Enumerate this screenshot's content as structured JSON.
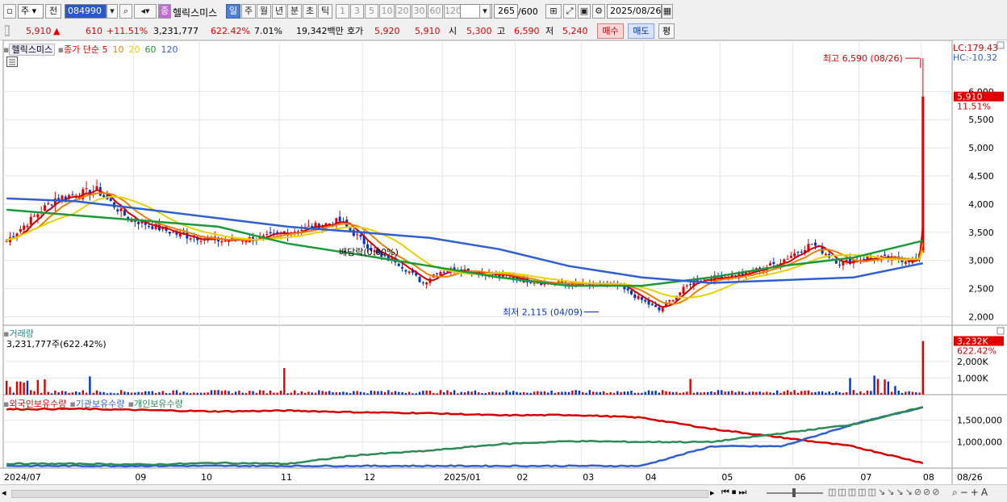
{
  "toolbar": {
    "period_select": "주",
    "prev_label": "전",
    "code": "084990",
    "stock_name": "헬릭스미스",
    "stock_badge": "종",
    "period_tabs": [
      "일",
      "주",
      "월",
      "년",
      "분",
      "초",
      "틱"
    ],
    "active_tab": "일",
    "minute_tabs": [
      "1",
      "3",
      "5",
      "10",
      "20",
      "30",
      "60",
      "120"
    ],
    "count_value": "265",
    "count_max": "/600",
    "date_value": "2025/08/26"
  },
  "quote": {
    "price": "5,910",
    "change": "610",
    "change_pct": "+11.51%",
    "volume": "3,231,777",
    "volume_ratio": "622.42%",
    "turnover": "7.01%",
    "amount": "19,342백만",
    "ask_label": "호가",
    "ask_price": "5,920",
    "bid_price": "5,910",
    "open_label": "시",
    "open": "5,300",
    "high_label": "고",
    "high": "6,590",
    "low_label": "저",
    "low": "5,240",
    "buy_label": "매수",
    "sell_label": "매도",
    "avg_label": "평"
  },
  "price_panel": {
    "stock_label": "헬릭스미스",
    "ma_title": "종가 단순",
    "ma_labels": [
      {
        "text": "5",
        "color": "#d40000"
      },
      {
        "text": "10",
        "color": "#f08000"
      },
      {
        "text": "20",
        "color": "#e6d200"
      },
      {
        "text": "60",
        "color": "#1a9a3a"
      },
      {
        "text": "120",
        "color": "#2f5fd0"
      }
    ],
    "lc_label": "LC:179.43",
    "hc_label": "HC:-10.32",
    "current_tag": "5,910",
    "current_pct": "11.51%",
    "high_annot": "최고 6,590 (08/26)",
    "low_annot": "최저 2,115 (04/09)",
    "dividend_annot": "배당락(0.00%)"
  },
  "volume_panel": {
    "title": "거래량",
    "subtitle": "3,231,777주(622.42%)",
    "current_tag": "3,232K",
    "current_pct": "622.42%"
  },
  "holdings_panel": {
    "legend": [
      {
        "text": "외국인보유수량",
        "color": "#d40000"
      },
      {
        "text": "기관보유수량",
        "color": "#2f5fd0"
      },
      {
        "text": "개인보유수량",
        "color": "#2e8b57"
      }
    ]
  },
  "colors": {
    "up": "#e00000",
    "down": "#0033cc",
    "grid": "#e4e4e4"
  },
  "chart_data": [
    {
      "type": "candlestick",
      "title": "헬릭스미스",
      "y_ticks": [
        2000,
        2500,
        3000,
        3500,
        4000,
        4500,
        5000,
        5500,
        6000
      ],
      "y_tick_labels": [
        "2,000",
        "2,500",
        "3,000",
        "3,500",
        "4,000",
        "4,500",
        "5,000",
        "5,500",
        "6,000"
      ],
      "ylim": [
        1850,
        6850
      ],
      "x_tick_labels": [
        "2024/07",
        "09",
        "10",
        "11",
        "12",
        "2025/01",
        "02",
        "03",
        "04",
        "05",
        "06",
        "07",
        "08",
        "08/26"
      ],
      "close_anchors": [
        {
          "date": "2024/07",
          "close": 3350
        },
        {
          "date": "2024/07 late",
          "close": 4100
        },
        {
          "date": "2024/08",
          "close": 4250
        },
        {
          "date": "2024/08 late",
          "close": 3750
        },
        {
          "date": "2024/09",
          "close": 3450
        },
        {
          "date": "2024/09 late",
          "close": 3350
        },
        {
          "date": "2024/10",
          "close": 3400
        },
        {
          "date": "2024/10 mid",
          "close": 3600
        },
        {
          "date": "2024/11",
          "close": 3700
        },
        {
          "date": "2024/11 mid",
          "close": 3050
        },
        {
          "date": "2024/12",
          "close": 3000
        },
        {
          "date": "2024/12 mid",
          "close": 2600
        },
        {
          "date": "2024/12 late",
          "close": 2800
        },
        {
          "date": "2025/01",
          "close": 2850
        },
        {
          "date": "2025/02",
          "close": 2600
        },
        {
          "date": "2025/03",
          "close": 2550
        },
        {
          "date": "2025/04/09",
          "close": 2115
        },
        {
          "date": "2025/04 late",
          "close": 2650
        },
        {
          "date": "2025/05",
          "close": 2750
        },
        {
          "date": "2025/05 late",
          "close": 2950
        },
        {
          "date": "2025/06",
          "close": 3300
        },
        {
          "date": "2025/06 mid",
          "close": 2950
        },
        {
          "date": "2025/07",
          "close": 3050
        },
        {
          "date": "2025/07 late",
          "close": 3000
        },
        {
          "date": "2025/08",
          "close": 3300
        },
        {
          "date": "2025/08 mid",
          "close": 4100
        },
        {
          "date": "2025/08/26",
          "close": 5910
        }
      ],
      "series": [
        {
          "name": "5",
          "color": "#d40000"
        },
        {
          "name": "10",
          "color": "#f08000"
        },
        {
          "name": "20",
          "color": "#e6d200"
        },
        {
          "name": "60",
          "color": "#1a9a3a",
          "values_approx": [
            3900,
            3800,
            3700,
            3600,
            3300,
            3100,
            2900,
            2700,
            2550,
            2550,
            2700,
            2900,
            3050,
            3350
          ]
        },
        {
          "name": "120",
          "color": "#2f5fd0",
          "values_approx": [
            4100,
            4050,
            3900,
            3750,
            3600,
            3500,
            3400,
            3200,
            2900,
            2700,
            2600,
            2650,
            2700,
            2950
          ]
        }
      ]
    },
    {
      "type": "bar",
      "title": "거래량",
      "y_ticks": [
        1000000,
        2000000
      ],
      "y_tick_labels": [
        "1,000K",
        "2,000K"
      ],
      "ylim": [
        0,
        3500000
      ],
      "peaks": [
        {
          "date": "2024/08",
          "value": 1100000
        },
        {
          "date": "2024/10",
          "value": 1600000
        },
        {
          "date": "2025/02",
          "value": 950000
        },
        {
          "date": "2025/08 mid",
          "value": 1600000
        },
        {
          "date": "2025/08/26",
          "value": 3231777
        }
      ]
    },
    {
      "type": "line",
      "title": "보유수량",
      "y_ticks": [
        1000000,
        1500000
      ],
      "y_tick_labels": [
        "1,000,000",
        "1,500,000"
      ],
      "ylim": [
        400000,
        1900000
      ],
      "series": [
        {
          "name": "외국인보유수량",
          "color": "#d40000",
          "values_approx": [
            1750000,
            1760000,
            1730000,
            1700000,
            1720000,
            1680000,
            1660000,
            1610000,
            1620000,
            1560000,
            1300000,
            1100000,
            900000,
            520000
          ]
        },
        {
          "name": "기관보유수량",
          "color": "#2f5fd0",
          "values_approx": [
            450000,
            450000,
            450000,
            450000,
            450000,
            450000,
            450000,
            450000,
            450000,
            450000,
            900000,
            900000,
            1400000,
            1800000
          ]
        },
        {
          "name": "개인보유수량",
          "color": "#2e8b57",
          "values_approx": [
            500000,
            500000,
            480000,
            520000,
            500000,
            700000,
            800000,
            950000,
            1020000,
            1000000,
            1000000,
            1200000,
            1400000,
            1800000
          ]
        }
      ]
    }
  ]
}
